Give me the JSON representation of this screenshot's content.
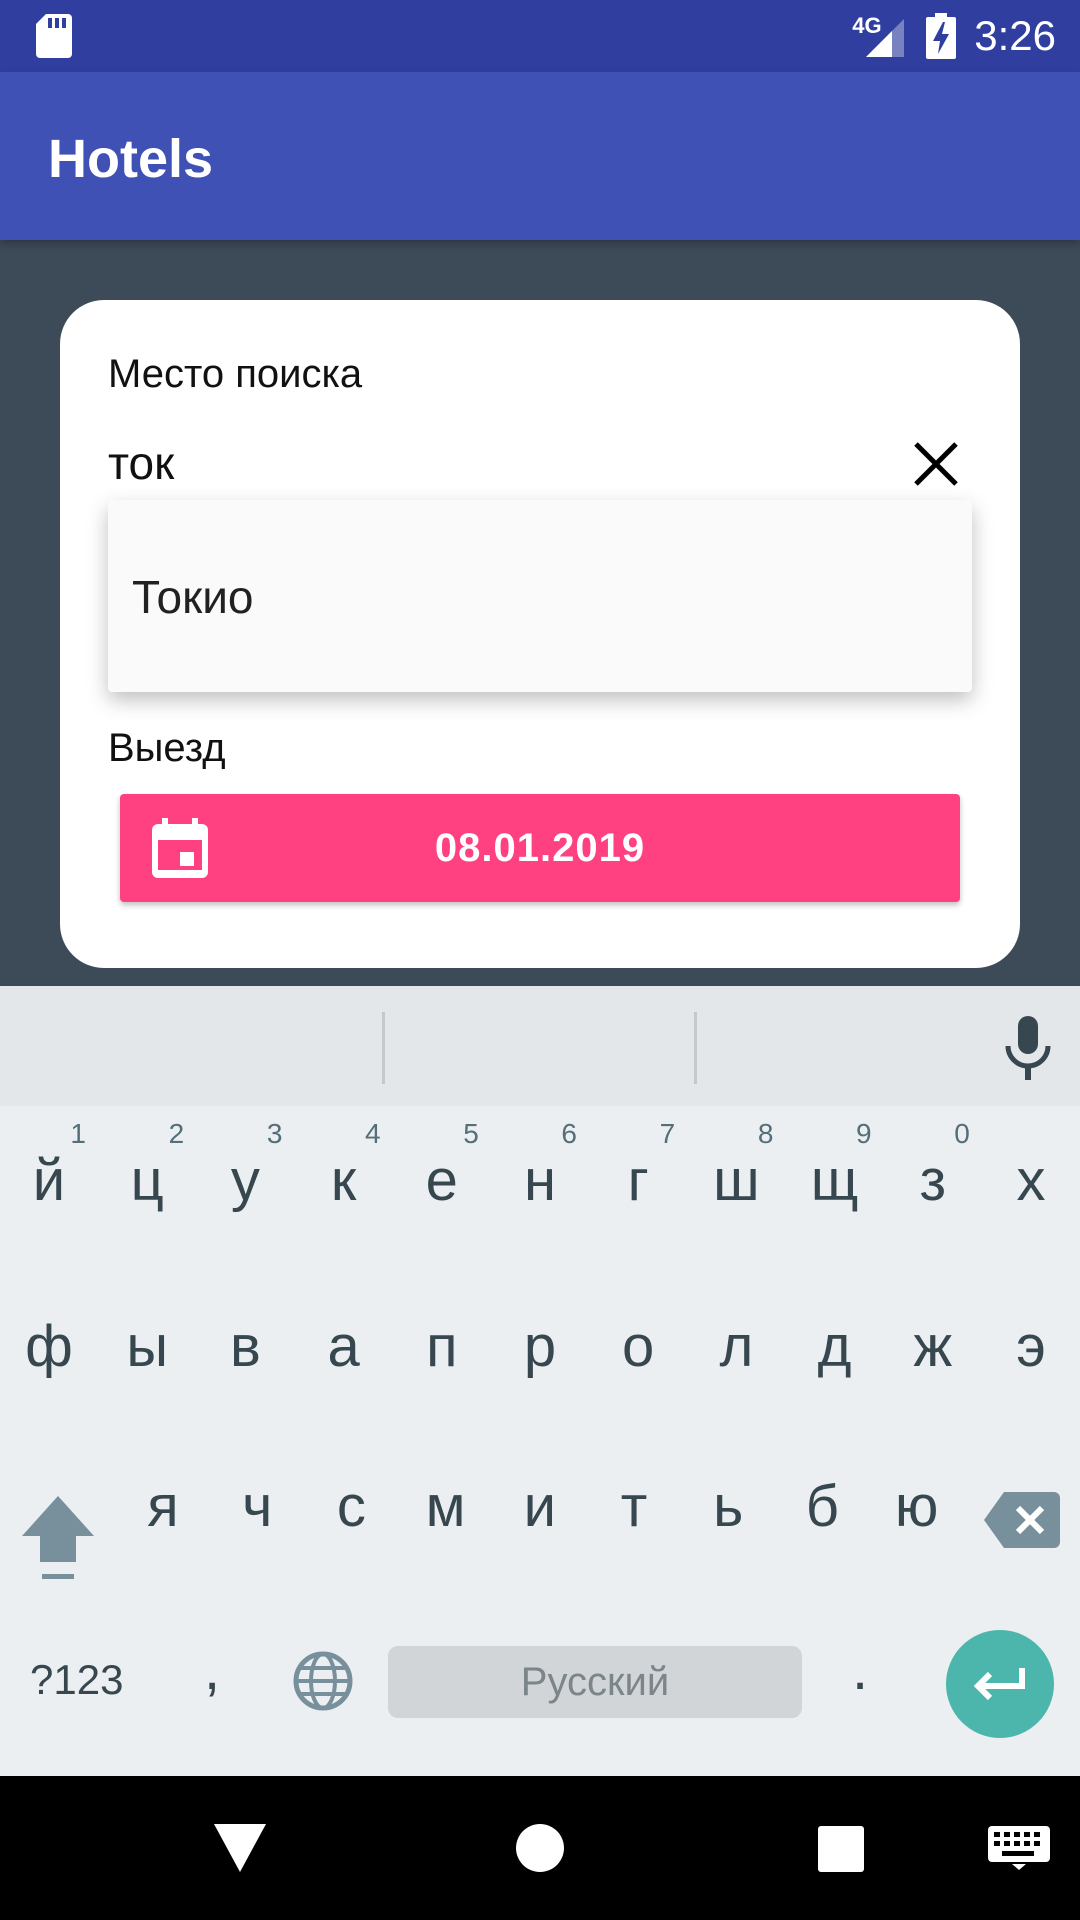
{
  "status_bar": {
    "time": "3:26",
    "network": "4G",
    "icons": [
      "sd-card-icon",
      "signal-icon",
      "battery-charging-icon"
    ]
  },
  "app_bar": {
    "title": "Hotels"
  },
  "search_card": {
    "location_label": "Место поиска",
    "location_query": "ток",
    "checkout_label": "Выезд",
    "checkout_date": "08.01.2019",
    "colors": {
      "accent": "#ff4081",
      "underline": "#d81b60"
    }
  },
  "suggestions": {
    "items": [
      "Токио"
    ]
  },
  "keyboard": {
    "row1": [
      {
        "ch": "й",
        "hint": "1"
      },
      {
        "ch": "ц",
        "hint": "2"
      },
      {
        "ch": "у",
        "hint": "3"
      },
      {
        "ch": "к",
        "hint": "4"
      },
      {
        "ch": "е",
        "hint": "5"
      },
      {
        "ch": "н",
        "hint": "6"
      },
      {
        "ch": "г",
        "hint": "7"
      },
      {
        "ch": "ш",
        "hint": "8"
      },
      {
        "ch": "щ",
        "hint": "9"
      },
      {
        "ch": "з",
        "hint": "0"
      },
      {
        "ch": "х",
        "hint": ""
      }
    ],
    "row2": [
      "ф",
      "ы",
      "в",
      "а",
      "п",
      "р",
      "о",
      "л",
      "д",
      "ж",
      "э"
    ],
    "row3": [
      "я",
      "ч",
      "с",
      "м",
      "и",
      "т",
      "ь",
      "б",
      "ю"
    ],
    "symbols_label": "?123",
    "comma": ",",
    "space_label": "Русский",
    "period": ".",
    "colors": {
      "background": "#eceff1",
      "enter": "#4db6ac"
    }
  }
}
